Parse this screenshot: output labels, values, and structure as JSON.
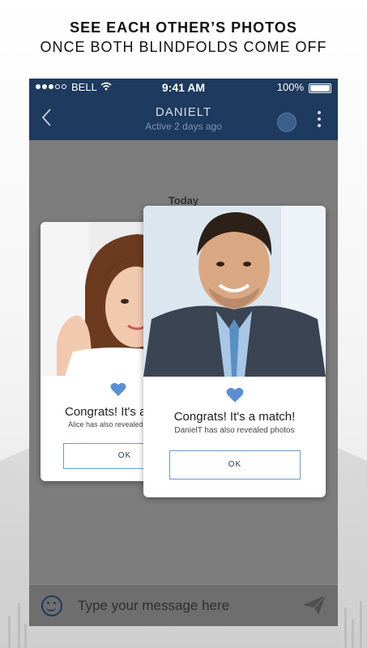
{
  "headline": {
    "line1": "SEE EACH OTHER’S PHOTOS",
    "line2": "ONCE BOTH BLINDFOLDS COME OFF"
  },
  "status_bar": {
    "carrier": "BELL",
    "time": "9:41 AM",
    "battery": "100%",
    "icons": [
      "signal-dots-icon",
      "wifi-icon",
      "battery-icon"
    ]
  },
  "chat_header": {
    "name": "DANIELT",
    "subtitle": "Active 2 days ago",
    "icons": [
      "back-chevron-icon",
      "blindfold-toggle-icon",
      "more-vertical-icon"
    ]
  },
  "chat": {
    "date_label": "Today"
  },
  "match_cards": [
    {
      "title": "Congrats! It's a r",
      "subtitle": "Alice has also revealed",
      "button": "OK",
      "photo": "woman-portrait"
    },
    {
      "title": "Congrats! It's a match!",
      "subtitle": "DanielT has also revealed photos",
      "button": "OK",
      "photo": "man-portrait"
    }
  ],
  "composer": {
    "placeholder": "Type your message here",
    "icons": [
      "emoji-icon",
      "send-icon"
    ]
  },
  "colors": {
    "header_bg": "#1e3a5e",
    "heart": "#5b8fd1",
    "overlay_bg": "#7d7d7d"
  }
}
